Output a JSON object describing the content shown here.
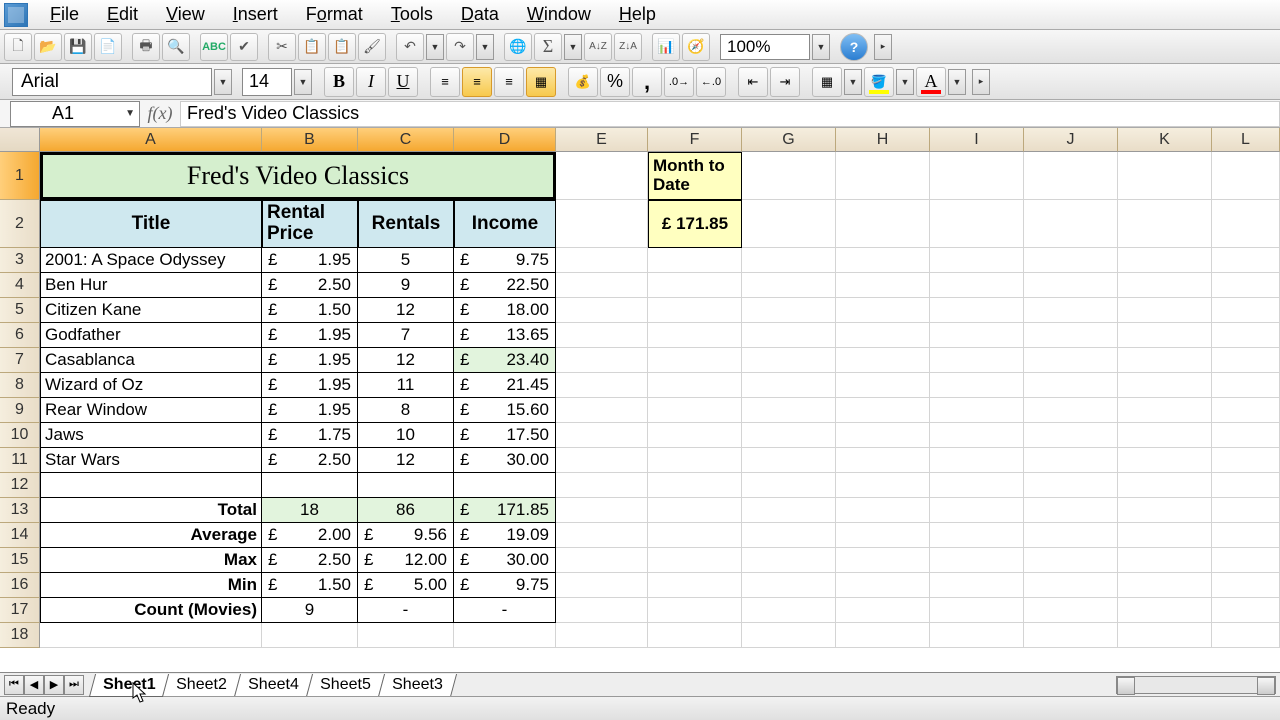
{
  "menu": {
    "file": "File",
    "edit": "Edit",
    "view": "View",
    "insert": "Insert",
    "format": "Format",
    "tools": "Tools",
    "data": "Data",
    "window": "Window",
    "help": "Help"
  },
  "zoom": "100%",
  "font_name": "Arial",
  "font_size": "14",
  "name_box": "A1",
  "formula": "Fred's Video Classics",
  "columns": [
    "A",
    "B",
    "C",
    "D",
    "E",
    "F",
    "G",
    "H",
    "I",
    "J",
    "K",
    "L"
  ],
  "row_numbers": [
    "1",
    "2",
    "3",
    "4",
    "5",
    "6",
    "7",
    "8",
    "9",
    "10",
    "11",
    "12",
    "13",
    "14",
    "15",
    "16",
    "17",
    "18"
  ],
  "title": "Fred's Video Classics",
  "headers": {
    "title": "Title",
    "price": "Rental Price",
    "rentals": "Rentals",
    "income": "Income"
  },
  "month_to_date_label": "Month to Date",
  "month_to_date_value": "£ 171.85",
  "movies": [
    {
      "title": "2001: A Space Odyssey",
      "price": "1.95",
      "rentals": "5",
      "income": "9.75"
    },
    {
      "title": "Ben Hur",
      "price": "2.50",
      "rentals": "9",
      "income": "22.50"
    },
    {
      "title": "Citizen Kane",
      "price": "1.50",
      "rentals": "12",
      "income": "18.00"
    },
    {
      "title": "Godfather",
      "price": "1.95",
      "rentals": "7",
      "income": "13.65"
    },
    {
      "title": "Casablanca",
      "price": "1.95",
      "rentals": "12",
      "income": "23.40"
    },
    {
      "title": "Wizard of Oz",
      "price": "1.95",
      "rentals": "11",
      "income": "21.45"
    },
    {
      "title": "Rear Window",
      "price": "1.95",
      "rentals": "8",
      "income": "15.60"
    },
    {
      "title": "Jaws",
      "price": "1.75",
      "rentals": "10",
      "income": "17.50"
    },
    {
      "title": "Star Wars",
      "price": "2.50",
      "rentals": "12",
      "income": "30.00"
    }
  ],
  "summary": {
    "total": {
      "label": "Total",
      "b": "18",
      "c": "86",
      "d": "171.85"
    },
    "average": {
      "label": "Average",
      "b": "2.00",
      "c": "9.56",
      "d": "19.09"
    },
    "max": {
      "label": "Max",
      "b": "2.50",
      "c": "12.00",
      "d": "30.00"
    },
    "min": {
      "label": "Min",
      "b": "1.50",
      "c": "5.00",
      "d": "9.75"
    },
    "count": {
      "label": "Count (Movies)",
      "b": "9",
      "c": "-",
      "d": "-"
    }
  },
  "sheets": [
    "Sheet1",
    "Sheet2",
    "Sheet4",
    "Sheet5",
    "Sheet3"
  ],
  "status": "Ready",
  "currency": "£"
}
